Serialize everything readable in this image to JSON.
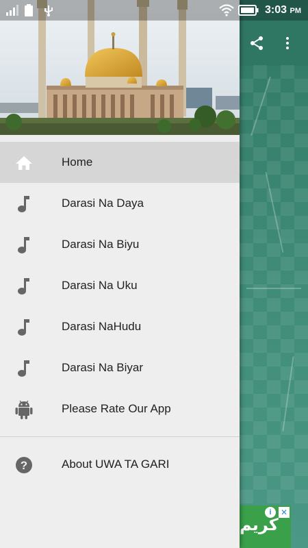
{
  "status_bar": {
    "time": "3:03",
    "ampm": "PM",
    "icons": [
      "signal-icon",
      "battery-small-icon",
      "usb-icon",
      "wifi-icon",
      "battery-icon"
    ]
  },
  "toolbar": {
    "actions": [
      "share-icon",
      "overflow-menu-icon"
    ]
  },
  "drawer": {
    "header_image": "mosque-photo",
    "items": [
      {
        "label": "Home",
        "icon": "home-icon",
        "active": true
      },
      {
        "label": "Darasi Na Daya",
        "icon": "music-note-icon"
      },
      {
        "label": "Darasi Na Biyu",
        "icon": "music-note-icon"
      },
      {
        "label": "Darasi Na Uku",
        "icon": "music-note-icon"
      },
      {
        "label": "Darasi NaHudu",
        "icon": "music-note-icon"
      },
      {
        "label": "Darasi Na Biyar",
        "icon": "music-note-icon"
      },
      {
        "label": "Please Rate Our App",
        "icon": "android-icon"
      }
    ],
    "secondary_items": [
      {
        "label": "About UWA TA GARI",
        "icon": "help-icon"
      }
    ]
  },
  "ad": {
    "text": "كريم",
    "info_symbol": "i",
    "close_symbol": "✕"
  },
  "colors": {
    "drawer_bg": "#eeeeee",
    "active_item_bg": "#d6d6d6",
    "app_primary": "#2f7763",
    "icon_gray": "#666666"
  }
}
